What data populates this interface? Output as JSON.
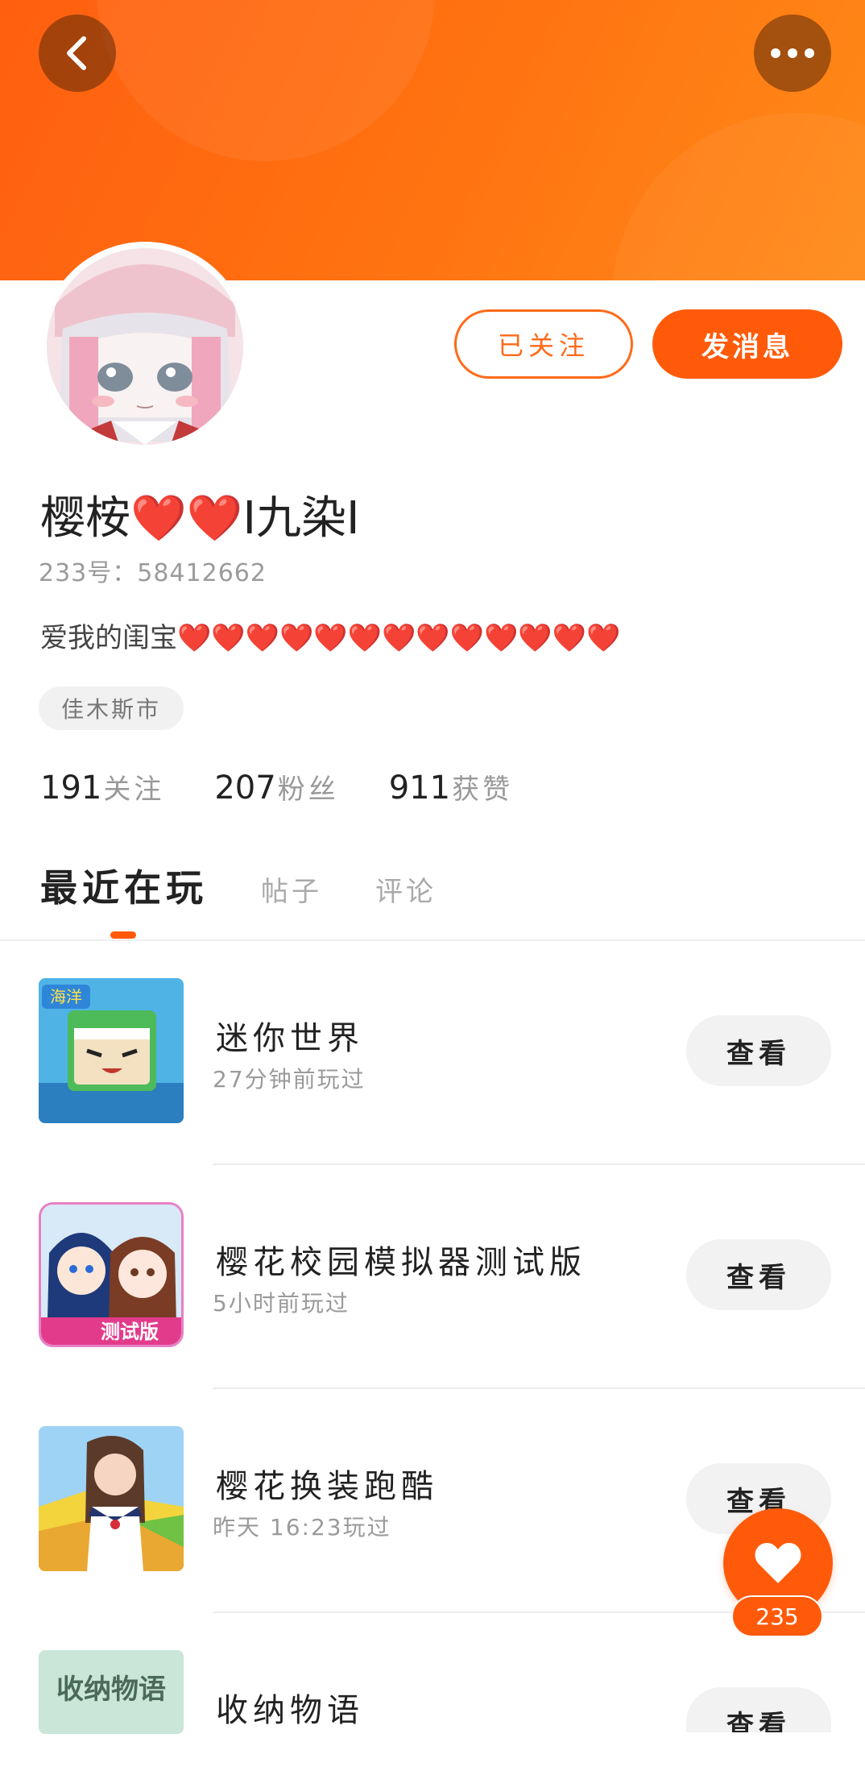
{
  "profile": {
    "nickname_prefix": "樱桉",
    "nickname_hearts": "❤️❤️",
    "nickname_suffix": "I九染I",
    "uid": "233号：58412662",
    "signature_text": "爱我的闺宝",
    "signature_hearts": "❤️❤️❤️❤️❤️❤️❤️❤️❤️❤️❤️❤️❤️",
    "location": "佳木斯市"
  },
  "actions": {
    "follow_label": "已关注",
    "message_label": "发消息"
  },
  "stats": [
    {
      "value": "191",
      "label": "关注"
    },
    {
      "value": "207",
      "label": "粉丝"
    },
    {
      "value": "911",
      "label": "获赞"
    }
  ],
  "tabs": [
    {
      "label": "最近在玩",
      "active": true
    },
    {
      "label": "帖子",
      "active": false
    },
    {
      "label": "评论",
      "active": false
    }
  ],
  "games": [
    {
      "name": "迷你世界",
      "played": "27分钟前玩过",
      "button": "查看",
      "thumb_text": "海洋"
    },
    {
      "name": "樱花校园模拟器测试版",
      "played": "5小时前玩过",
      "button": "查看",
      "thumb_text": "测试版"
    },
    {
      "name": "樱花换装跑酷",
      "played": "昨天 16:23玩过",
      "button": "查看",
      "thumb_text": ""
    },
    {
      "name": "收纳物语",
      "played": "",
      "button": "查看",
      "thumb_text": "收纳物语"
    }
  ],
  "fab": {
    "count": "235"
  },
  "colors": {
    "accent": "#ff5a0a",
    "header_gradient_start": "#ff5f0f",
    "header_gradient_end": "#ff8a18"
  }
}
